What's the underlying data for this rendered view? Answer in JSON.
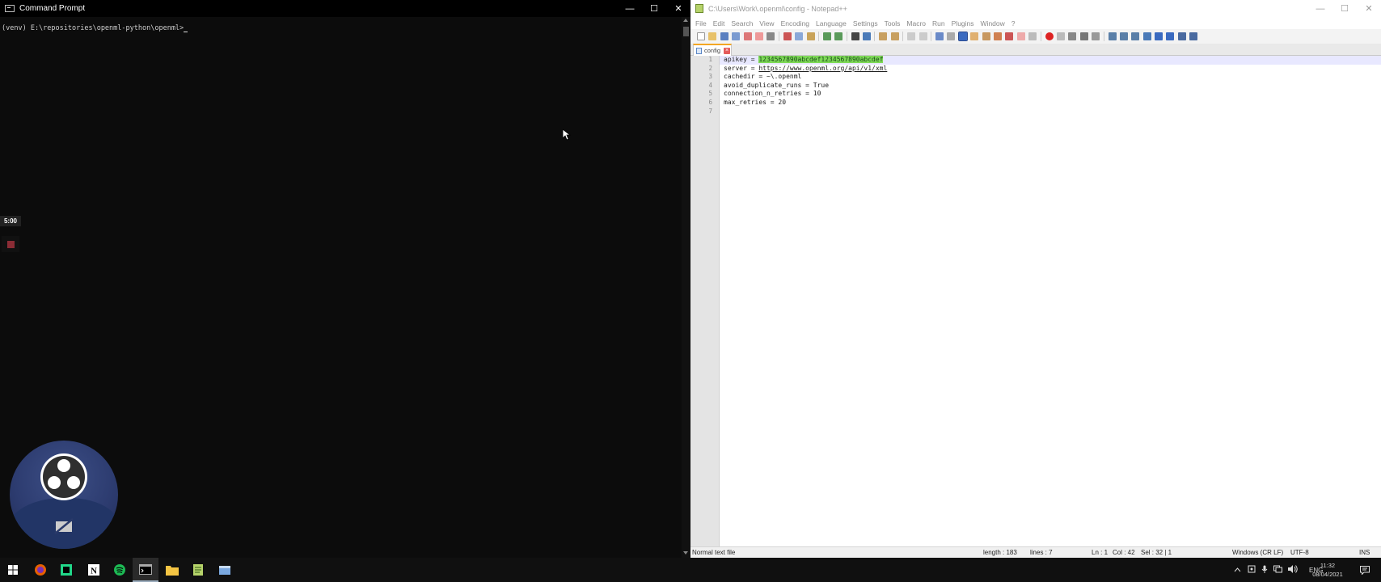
{
  "cmd": {
    "title": "Command Prompt",
    "prompt": "(venv) E:\\repositories\\openml-python\\openml>",
    "controls": {
      "minimize": "—",
      "maximize": "☐",
      "close": "✕"
    }
  },
  "obs": {
    "timer": "5:00"
  },
  "notepad": {
    "title": "C:\\Users\\Work\\.openml\\config - Notepad++",
    "menu": [
      "File",
      "Edit",
      "Search",
      "View",
      "Encoding",
      "Language",
      "Settings",
      "Tools",
      "Macro",
      "Run",
      "Plugins",
      "Window",
      "?"
    ],
    "tab_label": "config",
    "controls": {
      "minimize": "—",
      "maximize": "☐",
      "close": "✕"
    },
    "lines": [
      {
        "num": "1",
        "key": "apikey = ",
        "value": "1234567890abcdef1234567890abcdef"
      },
      {
        "num": "2",
        "key": "server = ",
        "value": "https://www.openml.org/api/v1/xml"
      },
      {
        "num": "3",
        "text": "cachedir = ~\\.openml"
      },
      {
        "num": "4",
        "text": "avoid_duplicate_runs = True"
      },
      {
        "num": "5",
        "text": "connection_n_retries = 10"
      },
      {
        "num": "6",
        "text": "max_retries = 20"
      },
      {
        "num": "7",
        "text": ""
      }
    ],
    "status": {
      "file_type": "Normal text file",
      "length": "length : 183",
      "lines": "lines : 7",
      "ln": "Ln : 1",
      "col": "Col : 42",
      "sel": "Sel : 32 | 1",
      "eol": "Windows (CR LF)",
      "encoding": "UTF-8",
      "mode": "INS"
    }
  },
  "taskbar": {
    "language": "ENG",
    "time": "11:32",
    "date": "08/04/2021"
  }
}
